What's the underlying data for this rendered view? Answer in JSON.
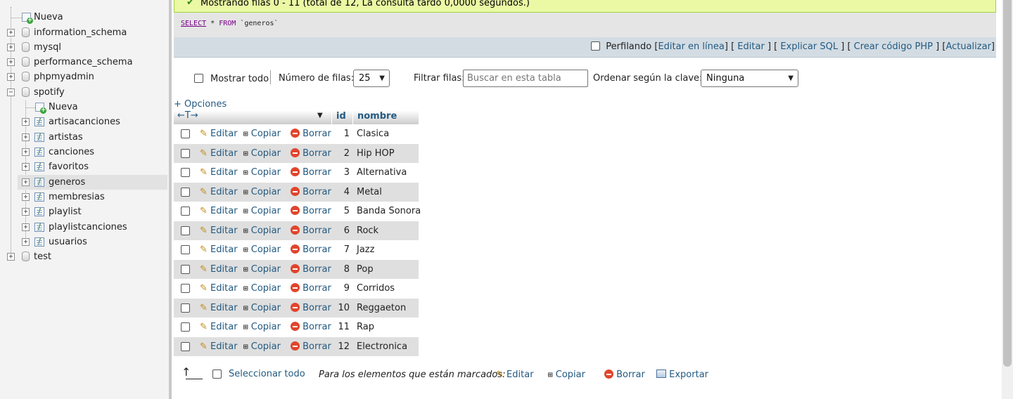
{
  "navigation": {
    "new_label": "Nueva",
    "databases": [
      {
        "name": "information_schema"
      },
      {
        "name": "mysql"
      },
      {
        "name": "performance_schema"
      },
      {
        "name": "phpmyadmin"
      },
      {
        "name": "spotify"
      },
      {
        "name": "test"
      }
    ],
    "spotify": {
      "new_label": "Nueva",
      "tables": [
        "artisacanciones",
        "artistas",
        "canciones",
        "favoritos",
        "generos",
        "membresias",
        "playlist",
        "playlistcanciones",
        "usuarios"
      ],
      "selected_table": "generos"
    },
    "expander_closed": "+",
    "expander_open": "−"
  },
  "message": {
    "check": "✔",
    "text": "Mostrando filas 0 - 11 (total de 12, La consulta tardó 0,0000 segundos.)"
  },
  "sql": {
    "select_kw": "SELECT",
    "star": "*",
    "from_kw": "FROM",
    "table": "`generos`"
  },
  "sql_actions": {
    "profiling": "Perfilando",
    "open_bracket": "[",
    "close_bracket": "]",
    "edit_inline": "Editar en línea",
    "edit": "Editar",
    "explain": "Explicar SQL",
    "create_php": "Crear código PHP",
    "refresh": "Actualizar"
  },
  "filters": {
    "show_all": "Mostrar todo",
    "rows_label": "Número de filas:",
    "rows_value": "25",
    "filter_label": "Filtrar filas:",
    "filter_placeholder": "Buscar en esta tabla",
    "sort_label": "Ordenar según la clave:",
    "sort_value": "Ninguna"
  },
  "options_link": "+ Opciones",
  "table": {
    "columns": [
      "id",
      "nombre"
    ],
    "sort_arrows": "←T→",
    "action_edit": "Editar",
    "action_copy": "Copiar",
    "action_delete": "Borrar",
    "rows": [
      {
        "id": "1",
        "nombre": "Clasica"
      },
      {
        "id": "2",
        "nombre": "Hip HOP"
      },
      {
        "id": "3",
        "nombre": "Alternativa"
      },
      {
        "id": "4",
        "nombre": "Metal"
      },
      {
        "id": "5",
        "nombre": "Banda Sonora"
      },
      {
        "id": "6",
        "nombre": "Rock"
      },
      {
        "id": "7",
        "nombre": "Jazz"
      },
      {
        "id": "8",
        "nombre": "Pop"
      },
      {
        "id": "9",
        "nombre": "Corridos"
      },
      {
        "id": "10",
        "nombre": "Reggaeton"
      },
      {
        "id": "11",
        "nombre": "Rap"
      },
      {
        "id": "12",
        "nombre": "Electronica"
      }
    ]
  },
  "bulk": {
    "select_all": "Seleccionar todo",
    "marked_label": "Para los elementos que están marcados:",
    "edit": "Editar",
    "copy": "Copiar",
    "delete": "Borrar",
    "export": "Exportar"
  },
  "colors": {
    "link": "#235a81",
    "success_bg": "#ebf8a4",
    "row_even": "#dfdfdf",
    "header_bar": "#d3dce3"
  }
}
